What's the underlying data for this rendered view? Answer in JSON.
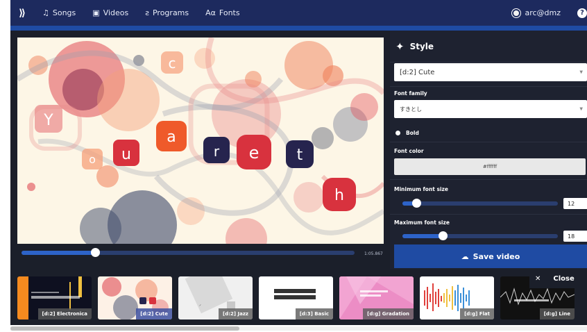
{
  "nav": {
    "items": [
      {
        "icon": "music-note-icon",
        "glyph": "♫",
        "label": "Songs"
      },
      {
        "icon": "video-icon",
        "glyph": "▣",
        "label": "Videos"
      },
      {
        "icon": "program-icon",
        "glyph": "ƨ",
        "label": "Programs"
      },
      {
        "icon": "font-icon",
        "glyph": "Aα",
        "label": "Fonts"
      }
    ],
    "user": "arc@dmz",
    "help_glyph": "?"
  },
  "preview": {
    "time": "1:05.867",
    "progress": 0.22,
    "letters": [
      "Y",
      "c",
      "u",
      "a",
      "r",
      "e",
      "t",
      "h",
      "o"
    ]
  },
  "style_panel": {
    "title": "Style",
    "preset_value": "[d:2] Cute",
    "font_family_label": "Font family",
    "font_family_value": "すきとし",
    "bold_label": "Bold",
    "font_color_label": "Font color",
    "font_color_value": "#ffffff",
    "min_font_label": "Minimum font size",
    "min_font_value": "12",
    "min_font_level": 0.09,
    "max_font_label": "Maximum font size",
    "max_font_value": "18",
    "max_font_level": 0.26,
    "save_label": "Save video"
  },
  "templates": [
    {
      "tag": "[d:2] Electronica"
    },
    {
      "tag": "[d:2] Cute"
    },
    {
      "tag": "[d:2] Jazz"
    },
    {
      "tag": "[d:3] Basic"
    },
    {
      "tag": "[d:g] Gradation"
    },
    {
      "tag": "[d:g] Flat"
    },
    {
      "tag": "[d:g] Line"
    }
  ],
  "close_label": "Close"
}
